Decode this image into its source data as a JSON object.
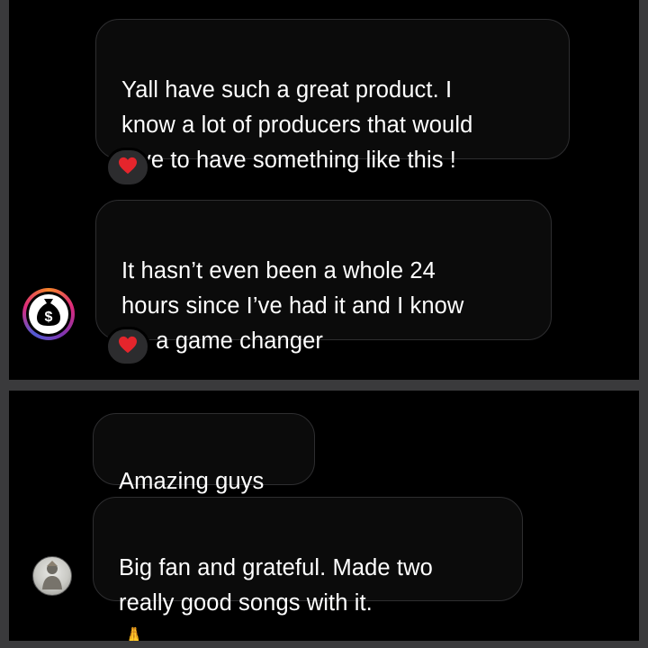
{
  "messages_top": [
    {
      "text": "Yall have such a great product. I\nknow a lot of producers that would\nlove to have something like this !",
      "reaction": "heart"
    },
    {
      "text": "It hasn’t even been a whole 24\nhours since I’ve had it and I know\nit’s a game changer",
      "reaction": "heart"
    }
  ],
  "messages_bottom": [
    {
      "text": "Amazing guys"
    },
    {
      "text": "Big fan and grateful. Made two\nreally good songs with it.",
      "emoji": "🙏"
    }
  ],
  "icons": {
    "reaction": "heart-icon",
    "avatar_top": "money-bag-icon",
    "avatar_bottom": "user-avatar-icon",
    "emoji": "folded-hands-icon"
  },
  "colors": {
    "background": "#000000",
    "bubble_border": "#2e2e30",
    "text": "#ffffff",
    "heart": "#e5252c",
    "reaction_pill": "#2c2c2e"
  }
}
